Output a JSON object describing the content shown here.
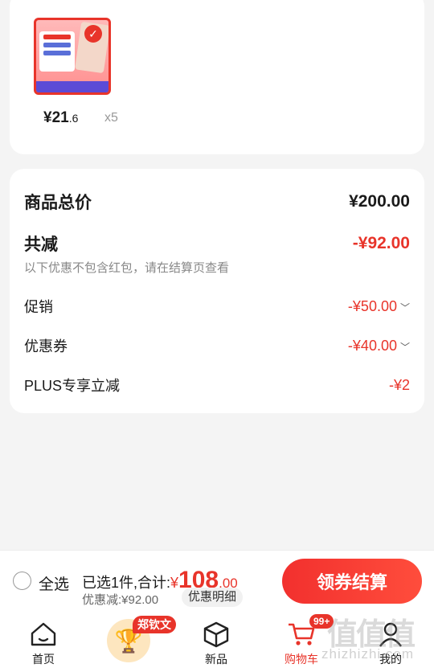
{
  "product": {
    "price_main": "¥21",
    "price_decimal": ".6",
    "quantity": "x5"
  },
  "summary": {
    "total_label": "商品总价",
    "total_value": "¥200.00",
    "save_label": "共减",
    "save_value": "-¥92.00",
    "note": "以下优惠不包含红包，请在结算页查看",
    "items": [
      {
        "label": "促销",
        "value": "-¥50.00"
      },
      {
        "label": "优惠券",
        "value": "-¥40.00"
      },
      {
        "label": "PLUS专享立减",
        "value": "-¥2"
      }
    ]
  },
  "checkout": {
    "select_all": "全选",
    "selected_text": "已选1件,合计:",
    "currency": "¥",
    "amount_int": "108",
    "amount_dec": ".00",
    "discount_text": "优惠减:¥92.00",
    "detail_button": "优惠明细",
    "pay_button": "领券结算"
  },
  "tabbar": {
    "home": "首页",
    "name_tag": "郑钦文",
    "new": "新品",
    "cart": "购物车",
    "cart_badge": "99+",
    "mine": "我的"
  },
  "watermark": "zhizhizhi.com",
  "colors": {
    "accent": "#e8342a"
  }
}
